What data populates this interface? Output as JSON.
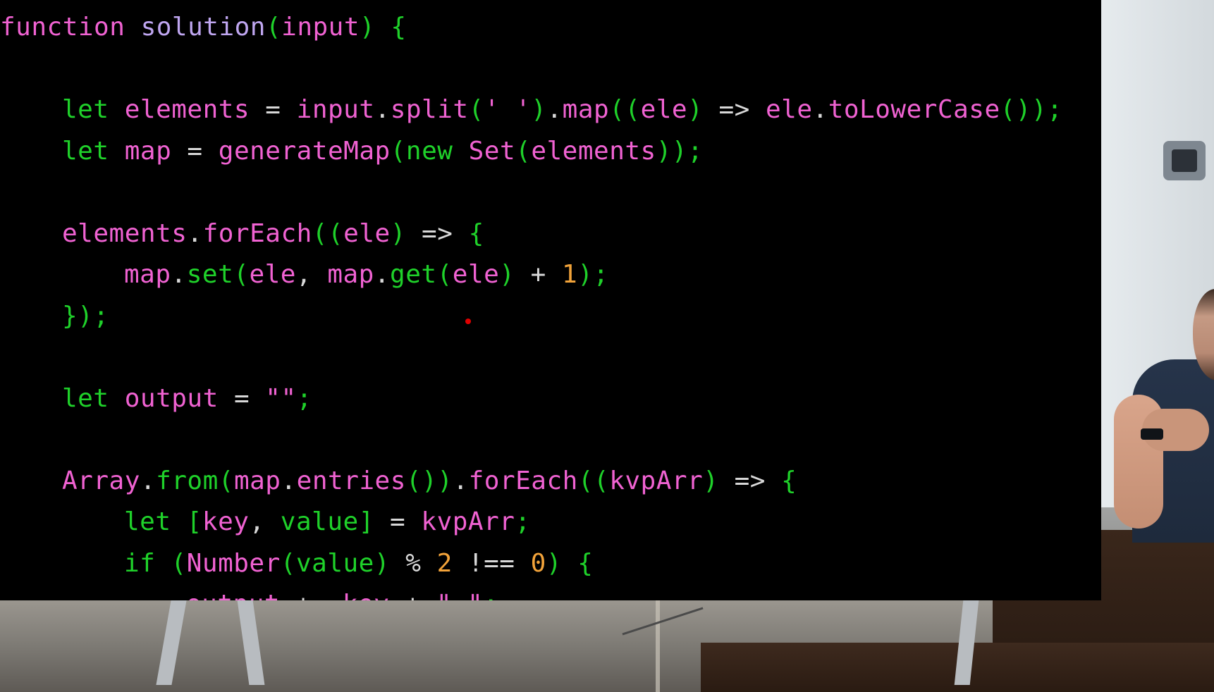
{
  "colors": {
    "keyword": "#1fd12a",
    "identifier": "#f062d2",
    "method": "#1fd12a",
    "number": "#f2a33a",
    "string": "#f062d2",
    "punct": "#d8d8d8",
    "plain": "#f062d2",
    "background": "#000000",
    "cursor": "#e00000"
  },
  "code": {
    "lines": [
      {
        "indent": 0,
        "tokens": [
          {
            "t": "function",
            "c": "identifier"
          },
          {
            "t": " ",
            "c": "punct"
          },
          {
            "t": "solution",
            "c": "plainblue"
          },
          {
            "t": "(",
            "c": "keyword"
          },
          {
            "t": "input",
            "c": "identifier"
          },
          {
            "t": ")",
            "c": "keyword"
          },
          {
            "t": " ",
            "c": "punct"
          },
          {
            "t": "{",
            "c": "keyword"
          }
        ]
      },
      {
        "indent": 0,
        "tokens": []
      },
      {
        "indent": 1,
        "tokens": [
          {
            "t": "let",
            "c": "keyword"
          },
          {
            "t": " ",
            "c": "punct"
          },
          {
            "t": "elements",
            "c": "identifier"
          },
          {
            "t": " = ",
            "c": "punct"
          },
          {
            "t": "input",
            "c": "identifier"
          },
          {
            "t": ".",
            "c": "punct"
          },
          {
            "t": "split",
            "c": "identifier"
          },
          {
            "t": "(",
            "c": "keyword"
          },
          {
            "t": "' '",
            "c": "string"
          },
          {
            "t": ")",
            "c": "keyword"
          },
          {
            "t": ".",
            "c": "punct"
          },
          {
            "t": "map",
            "c": "identifier"
          },
          {
            "t": "((",
            "c": "keyword"
          },
          {
            "t": "ele",
            "c": "identifier"
          },
          {
            "t": ")",
            "c": "keyword"
          },
          {
            "t": " => ",
            "c": "punct"
          },
          {
            "t": "ele",
            "c": "identifier"
          },
          {
            "t": ".",
            "c": "punct"
          },
          {
            "t": "toLowerCase",
            "c": "identifier"
          },
          {
            "t": "());",
            "c": "keyword"
          }
        ]
      },
      {
        "indent": 1,
        "tokens": [
          {
            "t": "let",
            "c": "keyword"
          },
          {
            "t": " ",
            "c": "punct"
          },
          {
            "t": "map",
            "c": "identifier"
          },
          {
            "t": " = ",
            "c": "punct"
          },
          {
            "t": "generateMap",
            "c": "identifier"
          },
          {
            "t": "(",
            "c": "keyword"
          },
          {
            "t": "new",
            "c": "keyword"
          },
          {
            "t": " ",
            "c": "punct"
          },
          {
            "t": "Set",
            "c": "identifier"
          },
          {
            "t": "(",
            "c": "keyword"
          },
          {
            "t": "elements",
            "c": "identifier"
          },
          {
            "t": "));",
            "c": "keyword"
          }
        ]
      },
      {
        "indent": 0,
        "tokens": []
      },
      {
        "indent": 1,
        "tokens": [
          {
            "t": "elements",
            "c": "identifier"
          },
          {
            "t": ".",
            "c": "punct"
          },
          {
            "t": "forEach",
            "c": "identifier"
          },
          {
            "t": "((",
            "c": "keyword"
          },
          {
            "t": "ele",
            "c": "identifier"
          },
          {
            "t": ")",
            "c": "keyword"
          },
          {
            "t": " => ",
            "c": "punct"
          },
          {
            "t": "{",
            "c": "keyword"
          }
        ]
      },
      {
        "indent": 2,
        "tokens": [
          {
            "t": "map",
            "c": "identifier"
          },
          {
            "t": ".",
            "c": "punct"
          },
          {
            "t": "set",
            "c": "method"
          },
          {
            "t": "(",
            "c": "keyword"
          },
          {
            "t": "ele",
            "c": "identifier"
          },
          {
            "t": ", ",
            "c": "punct"
          },
          {
            "t": "map",
            "c": "identifier"
          },
          {
            "t": ".",
            "c": "punct"
          },
          {
            "t": "get",
            "c": "method"
          },
          {
            "t": "(",
            "c": "keyword"
          },
          {
            "t": "ele",
            "c": "identifier"
          },
          {
            "t": ")",
            "c": "keyword"
          },
          {
            "t": " + ",
            "c": "punct"
          },
          {
            "t": "1",
            "c": "number"
          },
          {
            "t": ");",
            "c": "keyword"
          }
        ]
      },
      {
        "indent": 1,
        "tokens": [
          {
            "t": "});",
            "c": "keyword"
          }
        ]
      },
      {
        "indent": 0,
        "tokens": []
      },
      {
        "indent": 1,
        "tokens": [
          {
            "t": "let",
            "c": "keyword"
          },
          {
            "t": " ",
            "c": "punct"
          },
          {
            "t": "output",
            "c": "identifier"
          },
          {
            "t": " = ",
            "c": "punct"
          },
          {
            "t": "\"\"",
            "c": "string"
          },
          {
            "t": ";",
            "c": "keyword"
          }
        ]
      },
      {
        "indent": 0,
        "tokens": []
      },
      {
        "indent": 1,
        "tokens": [
          {
            "t": "Array",
            "c": "identifier"
          },
          {
            "t": ".",
            "c": "punct"
          },
          {
            "t": "from",
            "c": "method"
          },
          {
            "t": "(",
            "c": "keyword"
          },
          {
            "t": "map",
            "c": "identifier"
          },
          {
            "t": ".",
            "c": "punct"
          },
          {
            "t": "entries",
            "c": "identifier"
          },
          {
            "t": "())",
            "c": "keyword"
          },
          {
            "t": ".",
            "c": "punct"
          },
          {
            "t": "forEach",
            "c": "identifier"
          },
          {
            "t": "((",
            "c": "keyword"
          },
          {
            "t": "kvpArr",
            "c": "identifier"
          },
          {
            "t": ")",
            "c": "keyword"
          },
          {
            "t": " => ",
            "c": "punct"
          },
          {
            "t": "{",
            "c": "keyword"
          }
        ]
      },
      {
        "indent": 2,
        "tokens": [
          {
            "t": "let",
            "c": "keyword"
          },
          {
            "t": " ",
            "c": "punct"
          },
          {
            "t": "[",
            "c": "keyword"
          },
          {
            "t": "key",
            "c": "identifier"
          },
          {
            "t": ", ",
            "c": "punct"
          },
          {
            "t": "value",
            "c": "method"
          },
          {
            "t": "]",
            "c": "keyword"
          },
          {
            "t": " = ",
            "c": "punct"
          },
          {
            "t": "kvpArr",
            "c": "identifier"
          },
          {
            "t": ";",
            "c": "keyword"
          }
        ]
      },
      {
        "indent": 2,
        "tokens": [
          {
            "t": "if",
            "c": "keyword"
          },
          {
            "t": " ",
            "c": "punct"
          },
          {
            "t": "(",
            "c": "keyword"
          },
          {
            "t": "Number",
            "c": "identifier"
          },
          {
            "t": "(",
            "c": "keyword"
          },
          {
            "t": "value",
            "c": "method"
          },
          {
            "t": ")",
            "c": "keyword"
          },
          {
            "t": " % ",
            "c": "punct"
          },
          {
            "t": "2",
            "c": "number"
          },
          {
            "t": " !== ",
            "c": "punct"
          },
          {
            "t": "0",
            "c": "number"
          },
          {
            "t": ")",
            "c": "keyword"
          },
          {
            "t": " ",
            "c": "punct"
          },
          {
            "t": "{",
            "c": "keyword"
          }
        ]
      },
      {
        "indent": 3,
        "tokens": [
          {
            "t": "output",
            "c": "identifier"
          },
          {
            "t": " += ",
            "c": "punct"
          },
          {
            "t": "key",
            "c": "identifier"
          },
          {
            "t": " + ",
            "c": "punct"
          },
          {
            "t": "\" \"",
            "c": "string"
          },
          {
            "t": ";",
            "c": "keyword"
          }
        ]
      }
    ]
  }
}
